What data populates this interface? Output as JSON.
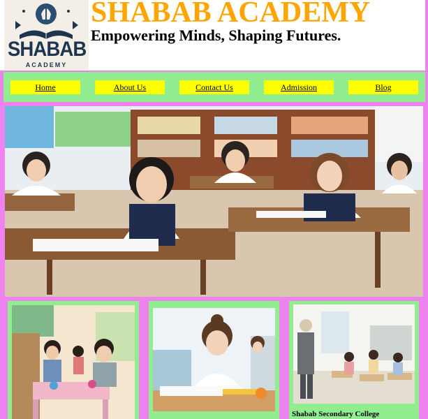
{
  "header": {
    "logo_text": "SHABAB",
    "logo_subtext": "ACADEMY",
    "title": "SHABAB ACADEMY",
    "tagline": "Empowering Minds, Shaping Futures."
  },
  "nav": {
    "items": [
      {
        "label": "Home"
      },
      {
        "label": "About Us"
      },
      {
        "label": "Contact Us"
      },
      {
        "label": "Admission"
      },
      {
        "label": "Blog"
      }
    ]
  },
  "cards": [
    {
      "caption": ""
    },
    {
      "caption": ""
    },
    {
      "caption": "Shabab Secondary College"
    }
  ],
  "colors": {
    "page_background": "#ee82ee",
    "title": "#ffa500",
    "nav_background": "#90ee90",
    "nav_button": "#ffff00",
    "logo_text": "#1e3550"
  },
  "icons": {
    "logo": "book-lightbulb-emblem"
  }
}
